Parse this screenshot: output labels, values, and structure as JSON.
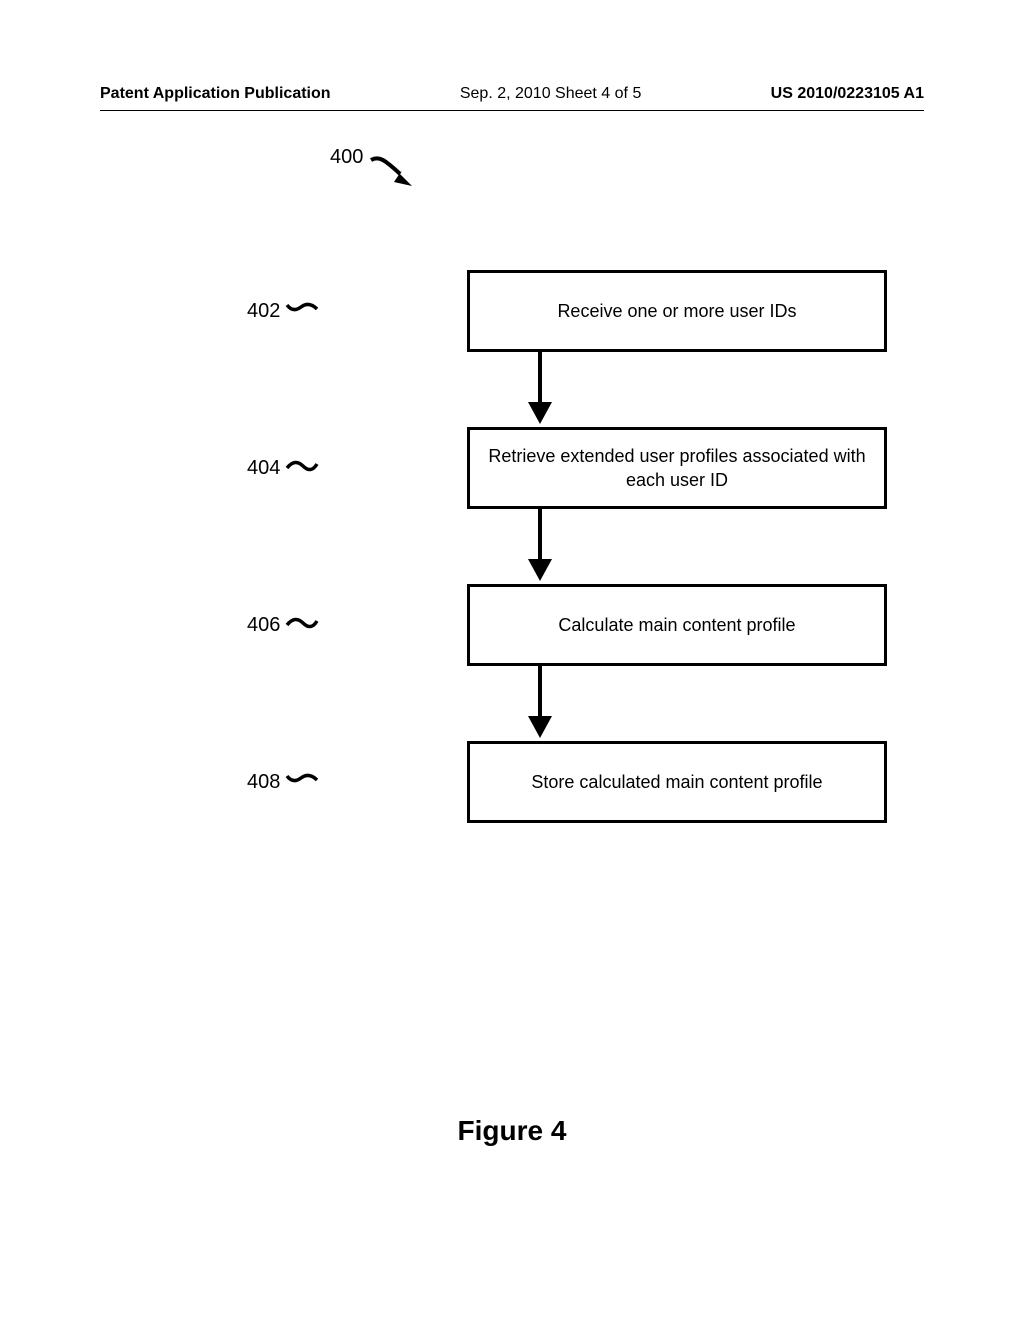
{
  "header": {
    "left": "Patent Application Publication",
    "center": "Sep. 2, 2010  Sheet 4 of 5",
    "right": "US 2010/0223105 A1"
  },
  "figure": {
    "number": "400",
    "caption": "Figure 4"
  },
  "steps": [
    {
      "id": "402",
      "text": "Receive one or more user IDs"
    },
    {
      "id": "404",
      "text": "Retrieve extended user profiles associated with each user ID"
    },
    {
      "id": "406",
      "text": "Calculate main content profile"
    },
    {
      "id": "408",
      "text": "Store calculated main content profile"
    }
  ]
}
